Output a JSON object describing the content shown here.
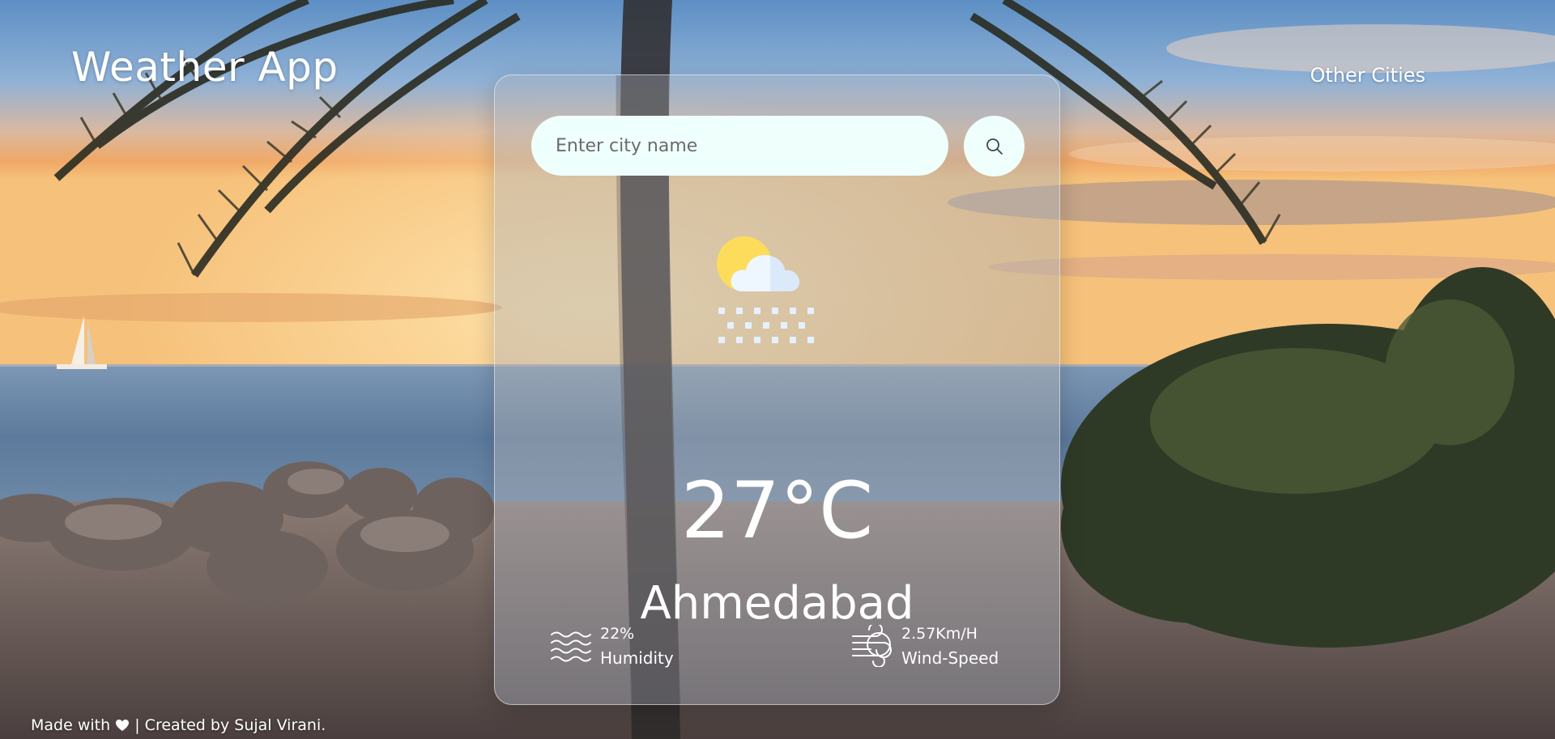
{
  "header": {
    "app_title": "Weather App",
    "nav_other_cities": "Other Cities"
  },
  "search": {
    "placeholder": "Enter city name",
    "value": "",
    "button_icon": "search-icon"
  },
  "weather": {
    "condition_icon": "sun-cloud-snow-icon",
    "temperature": "27°C",
    "city": "Ahmedabad",
    "humidity_value": "22%",
    "humidity_label": "Humidity",
    "humidity_icon": "humidity-waves-icon",
    "wind_value": "2.57Km/H",
    "wind_label": "Wind-Speed",
    "wind_icon": "wind-icon"
  },
  "footer": {
    "made_with": "Made with",
    "heart_icon": "heart-icon",
    "credit": "| Created by Sujal Virani."
  },
  "colors": {
    "search_bg": "#effffc",
    "text": "#ffffff",
    "sun": "#fddc5c",
    "cloud": "#eef6ff",
    "snow": "#e6f0ff"
  }
}
